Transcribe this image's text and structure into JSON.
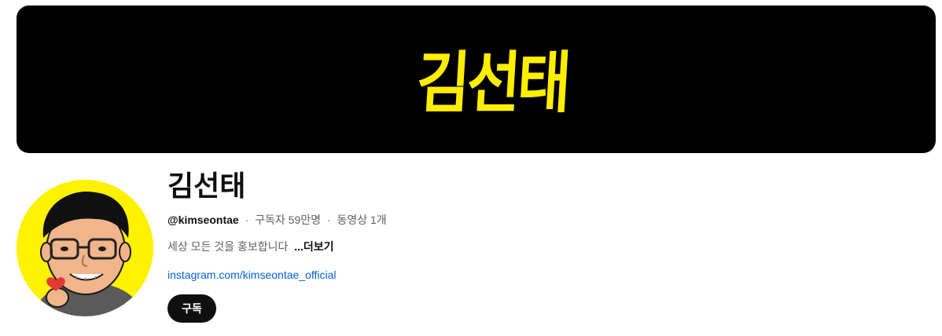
{
  "banner": {
    "logo_text": "김선태",
    "brand_color": "#ffee00",
    "background": "#000000"
  },
  "avatar": {
    "icon": "caricature-avatar",
    "background": "#fff200"
  },
  "channel": {
    "name": "김선태",
    "handle": "@kimseontae",
    "separator": "·",
    "subscribers": "구독자 59만명",
    "videos": "동영상 1개",
    "description": "세상 모든 것을 홍보합니다",
    "more_label": "...더보기",
    "link": "instagram.com/kimseontae_official",
    "link_color": "#065fd4"
  },
  "actions": {
    "subscribe_label": "구독"
  }
}
